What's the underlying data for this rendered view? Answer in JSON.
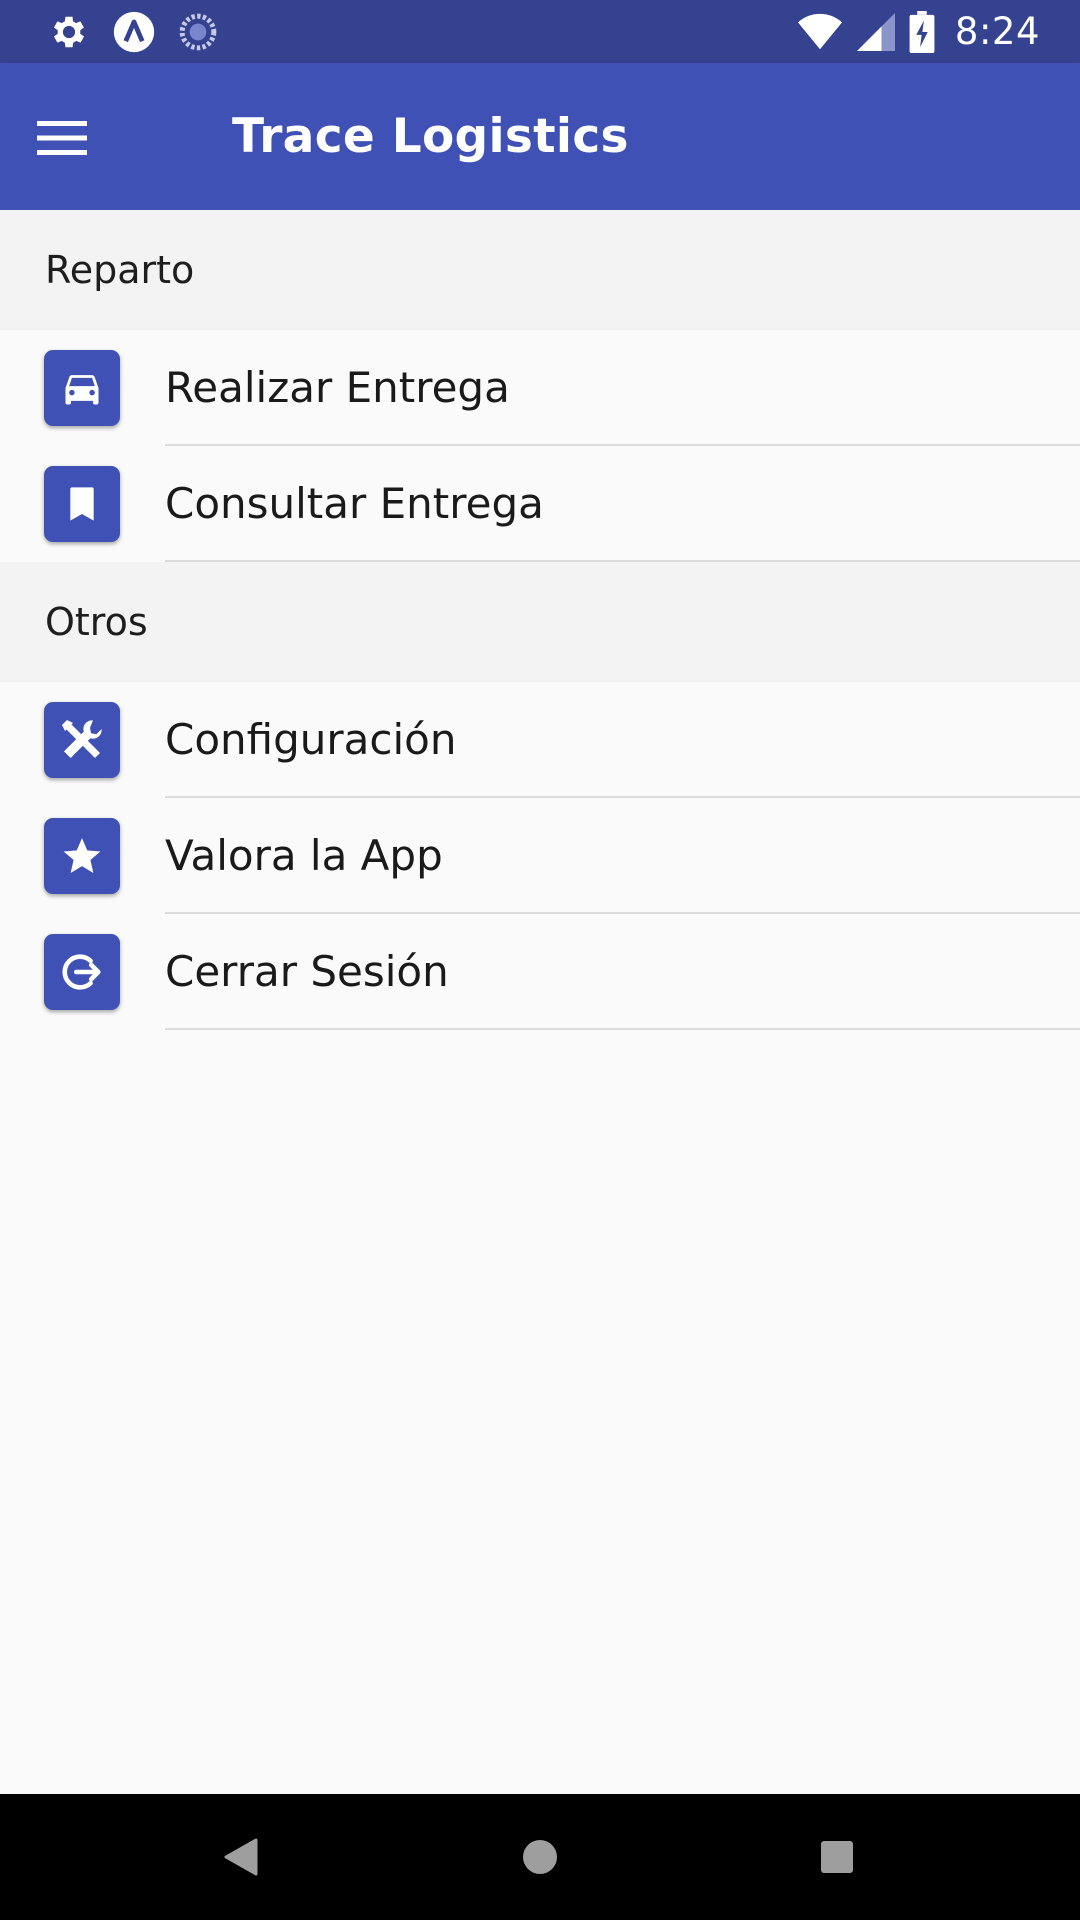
{
  "status_bar": {
    "time": "8:24",
    "left_icons": [
      "gear-icon",
      "app-a-icon",
      "sync-dots-icon"
    ],
    "right_icons": [
      "wifi-icon",
      "cell-signal-icon",
      "battery-charging-icon"
    ]
  },
  "app_bar": {
    "title": "Trace Logistics",
    "menu_icon": "hamburger-menu-icon",
    "color": "#3f51b5",
    "status_color": "#35428f"
  },
  "sections": [
    {
      "header": "Reparto",
      "items": [
        {
          "label": "Realizar Entrega",
          "icon": "car-icon"
        },
        {
          "label": "Consultar Entrega",
          "icon": "bookmark-icon"
        }
      ]
    },
    {
      "header": "Otros",
      "items": [
        {
          "label": "Configuración",
          "icon": "tools-icon"
        },
        {
          "label": "Valora la App",
          "icon": "star-icon"
        },
        {
          "label": "Cerrar Sesión",
          "icon": "logout-icon"
        }
      ]
    }
  ],
  "nav_bar": {
    "buttons": [
      "back-icon",
      "home-icon",
      "recents-icon"
    ]
  }
}
